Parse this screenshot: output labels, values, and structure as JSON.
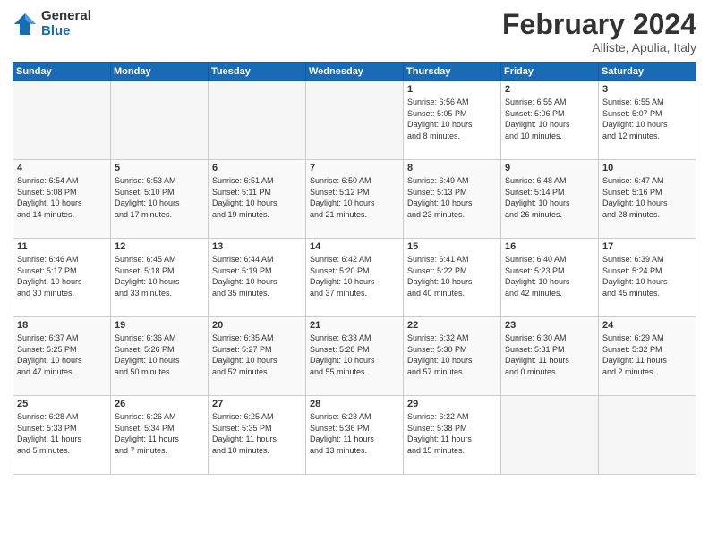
{
  "logo": {
    "general": "General",
    "blue": "Blue"
  },
  "title": "February 2024",
  "location": "Alliste, Apulia, Italy",
  "header_days": [
    "Sunday",
    "Monday",
    "Tuesday",
    "Wednesday",
    "Thursday",
    "Friday",
    "Saturday"
  ],
  "weeks": [
    [
      {
        "day": "",
        "info": ""
      },
      {
        "day": "",
        "info": ""
      },
      {
        "day": "",
        "info": ""
      },
      {
        "day": "",
        "info": ""
      },
      {
        "day": "1",
        "info": "Sunrise: 6:56 AM\nSunset: 5:05 PM\nDaylight: 10 hours\nand 8 minutes."
      },
      {
        "day": "2",
        "info": "Sunrise: 6:55 AM\nSunset: 5:06 PM\nDaylight: 10 hours\nand 10 minutes."
      },
      {
        "day": "3",
        "info": "Sunrise: 6:55 AM\nSunset: 5:07 PM\nDaylight: 10 hours\nand 12 minutes."
      }
    ],
    [
      {
        "day": "4",
        "info": "Sunrise: 6:54 AM\nSunset: 5:08 PM\nDaylight: 10 hours\nand 14 minutes."
      },
      {
        "day": "5",
        "info": "Sunrise: 6:53 AM\nSunset: 5:10 PM\nDaylight: 10 hours\nand 17 minutes."
      },
      {
        "day": "6",
        "info": "Sunrise: 6:51 AM\nSunset: 5:11 PM\nDaylight: 10 hours\nand 19 minutes."
      },
      {
        "day": "7",
        "info": "Sunrise: 6:50 AM\nSunset: 5:12 PM\nDaylight: 10 hours\nand 21 minutes."
      },
      {
        "day": "8",
        "info": "Sunrise: 6:49 AM\nSunset: 5:13 PM\nDaylight: 10 hours\nand 23 minutes."
      },
      {
        "day": "9",
        "info": "Sunrise: 6:48 AM\nSunset: 5:14 PM\nDaylight: 10 hours\nand 26 minutes."
      },
      {
        "day": "10",
        "info": "Sunrise: 6:47 AM\nSunset: 5:16 PM\nDaylight: 10 hours\nand 28 minutes."
      }
    ],
    [
      {
        "day": "11",
        "info": "Sunrise: 6:46 AM\nSunset: 5:17 PM\nDaylight: 10 hours\nand 30 minutes."
      },
      {
        "day": "12",
        "info": "Sunrise: 6:45 AM\nSunset: 5:18 PM\nDaylight: 10 hours\nand 33 minutes."
      },
      {
        "day": "13",
        "info": "Sunrise: 6:44 AM\nSunset: 5:19 PM\nDaylight: 10 hours\nand 35 minutes."
      },
      {
        "day": "14",
        "info": "Sunrise: 6:42 AM\nSunset: 5:20 PM\nDaylight: 10 hours\nand 37 minutes."
      },
      {
        "day": "15",
        "info": "Sunrise: 6:41 AM\nSunset: 5:22 PM\nDaylight: 10 hours\nand 40 minutes."
      },
      {
        "day": "16",
        "info": "Sunrise: 6:40 AM\nSunset: 5:23 PM\nDaylight: 10 hours\nand 42 minutes."
      },
      {
        "day": "17",
        "info": "Sunrise: 6:39 AM\nSunset: 5:24 PM\nDaylight: 10 hours\nand 45 minutes."
      }
    ],
    [
      {
        "day": "18",
        "info": "Sunrise: 6:37 AM\nSunset: 5:25 PM\nDaylight: 10 hours\nand 47 minutes."
      },
      {
        "day": "19",
        "info": "Sunrise: 6:36 AM\nSunset: 5:26 PM\nDaylight: 10 hours\nand 50 minutes."
      },
      {
        "day": "20",
        "info": "Sunrise: 6:35 AM\nSunset: 5:27 PM\nDaylight: 10 hours\nand 52 minutes."
      },
      {
        "day": "21",
        "info": "Sunrise: 6:33 AM\nSunset: 5:28 PM\nDaylight: 10 hours\nand 55 minutes."
      },
      {
        "day": "22",
        "info": "Sunrise: 6:32 AM\nSunset: 5:30 PM\nDaylight: 10 hours\nand 57 minutes."
      },
      {
        "day": "23",
        "info": "Sunrise: 6:30 AM\nSunset: 5:31 PM\nDaylight: 11 hours\nand 0 minutes."
      },
      {
        "day": "24",
        "info": "Sunrise: 6:29 AM\nSunset: 5:32 PM\nDaylight: 11 hours\nand 2 minutes."
      }
    ],
    [
      {
        "day": "25",
        "info": "Sunrise: 6:28 AM\nSunset: 5:33 PM\nDaylight: 11 hours\nand 5 minutes."
      },
      {
        "day": "26",
        "info": "Sunrise: 6:26 AM\nSunset: 5:34 PM\nDaylight: 11 hours\nand 7 minutes."
      },
      {
        "day": "27",
        "info": "Sunrise: 6:25 AM\nSunset: 5:35 PM\nDaylight: 11 hours\nand 10 minutes."
      },
      {
        "day": "28",
        "info": "Sunrise: 6:23 AM\nSunset: 5:36 PM\nDaylight: 11 hours\nand 13 minutes."
      },
      {
        "day": "29",
        "info": "Sunrise: 6:22 AM\nSunset: 5:38 PM\nDaylight: 11 hours\nand 15 minutes."
      },
      {
        "day": "",
        "info": ""
      },
      {
        "day": "",
        "info": ""
      }
    ]
  ]
}
